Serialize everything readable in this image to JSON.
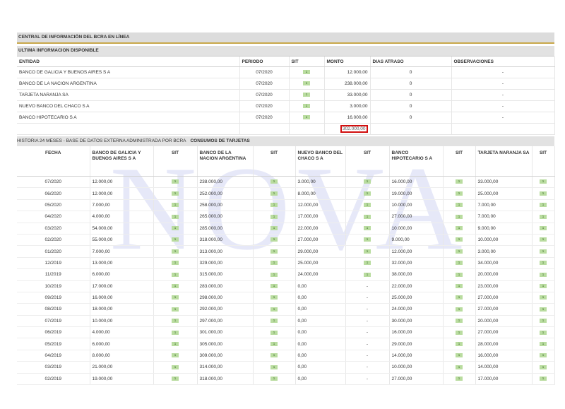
{
  "header": {
    "title": "CENTRAL DE INFORMACIÓN DEL BCRA EN LÍNEA",
    "subtitle": "ULTIMA INFORMACION DISPONIBLE"
  },
  "latest": {
    "columns": [
      "ENTIDAD",
      "PERIODO",
      "SIT",
      "MONTO",
      "DIAS ATRASO",
      "OBSERVACIONES"
    ],
    "rows": [
      {
        "entity": "BANCO DE GALICIA Y BUENOS AIRES S A",
        "period": "07/2020",
        "sit": "1",
        "amount": "12.000,00",
        "days": "0",
        "obs": "-"
      },
      {
        "entity": "BANCO DE LA NACION ARGENTINA",
        "period": "07/2020",
        "sit": "1",
        "amount": "238.000,00",
        "days": "0",
        "obs": "-"
      },
      {
        "entity": "TARJETA NARANJA SA",
        "period": "07/2020",
        "sit": "1",
        "amount": "33.000,00",
        "days": "0",
        "obs": "-"
      },
      {
        "entity": "NUEVO BANCO DEL CHACO S A",
        "period": "07/2020",
        "sit": "1",
        "amount": "3.000,00",
        "days": "0",
        "obs": "-"
      },
      {
        "entity": "BANCO HIPOTECARIO S A",
        "period": "07/2020",
        "sit": "1",
        "amount": "16.000,00",
        "days": "0",
        "obs": "-"
      }
    ],
    "total": "302.000,00"
  },
  "history": {
    "title": "HISTORIA 24 MESES - BASE DE DATOS EXTERNA ADMINISTRADA POR BCRA",
    "subtitle": "CONSUMOS DE TARJETAS",
    "columns": [
      "FECHA",
      "BANCO DE GALICIA Y BUENOS AIRES S A",
      "SIT",
      "BANCO DE LA NACION ARGENTINA",
      "SIT",
      "NUEVO BANCO DEL CHACO S A",
      "SIT",
      "BANCO HIPOTECARIO S A",
      "SIT",
      "TARJETA NARANJA SA",
      "SIT"
    ],
    "rows": [
      [
        "07/2020",
        "12.000,00",
        "1",
        "238.000,00",
        "1",
        "3.000,00",
        "1",
        "16.000,00",
        "1",
        "33.000,00",
        "1"
      ],
      [
        "06/2020",
        "12.000,00",
        "1",
        "252.000,00",
        "1",
        "8.000,00",
        "1",
        "19.000,00",
        "1",
        "25.000,00",
        "1"
      ],
      [
        "05/2020",
        "7.000,00",
        "1",
        "258.000,00",
        "1",
        "12.000,00",
        "1",
        "10.000,00",
        "1",
        "7.000,00",
        "1"
      ],
      [
        "04/2020",
        "4.000,00",
        "1",
        "265.000,00",
        "1",
        "17.000,00",
        "1",
        "27.000,00",
        "1",
        "7.000,00",
        "1"
      ],
      [
        "03/2020",
        "54.000,00",
        "1",
        "285.000,00",
        "1",
        "22.000,00",
        "1",
        "10.000,00",
        "1",
        "9.000,00",
        "1"
      ],
      [
        "02/2020",
        "55.000,00",
        "1",
        "318.000,00",
        "1",
        "27.000,00",
        "1",
        "9.000,00",
        "1",
        "10.000,00",
        "1"
      ],
      [
        "01/2020",
        "7.000,00",
        "1",
        "313.000,00",
        "1",
        "29.000,00",
        "1",
        "12.000,00",
        "1",
        "3.000,00",
        "1"
      ],
      [
        "12/2019",
        "13.000,00",
        "1",
        "329.000,00",
        "1",
        "25.000,00",
        "1",
        "32.000,00",
        "1",
        "34.000,00",
        "1"
      ],
      [
        "11/2019",
        "6.000,00",
        "1",
        "315.000,00",
        "1",
        "24.000,00",
        "1",
        "38.000,00",
        "1",
        "20.000,00",
        "1"
      ],
      [
        "10/2019",
        "17.000,00",
        "1",
        "283.000,00",
        "1",
        "0,00",
        "-",
        "22.000,00",
        "1",
        "23.000,00",
        "1"
      ],
      [
        "09/2019",
        "16.000,00",
        "1",
        "298.000,00",
        "1",
        "0,00",
        "-",
        "25.000,00",
        "1",
        "27.000,00",
        "1"
      ],
      [
        "08/2019",
        "18.000,00",
        "1",
        "292.000,00",
        "1",
        "0,00",
        "-",
        "24.000,00",
        "1",
        "27.000,00",
        "1"
      ],
      [
        "07/2019",
        "10.000,00",
        "1",
        "297.000,00",
        "1",
        "0,00",
        "-",
        "30.000,00",
        "1",
        "20.000,00",
        "1"
      ],
      [
        "06/2019",
        "4.000,00",
        "1",
        "301.000,00",
        "1",
        "0,00",
        "-",
        "16.000,00",
        "1",
        "27.000,00",
        "1"
      ],
      [
        "05/2019",
        "6.000,00",
        "1",
        "305.000,00",
        "1",
        "0,00",
        "-",
        "29.000,00",
        "1",
        "28.000,00",
        "1"
      ],
      [
        "04/2019",
        "8.000,00",
        "1",
        "309.000,00",
        "1",
        "0,00",
        "-",
        "14.000,00",
        "1",
        "16.000,00",
        "1"
      ],
      [
        "03/2019",
        "21.000,00",
        "1",
        "314.000,00",
        "1",
        "0,00",
        "-",
        "10.000,00",
        "1",
        "14.000,00",
        "1"
      ],
      [
        "02/2019",
        "19.000,00",
        "1",
        "318.000,00",
        "1",
        "0,00",
        "-",
        "27.000,00",
        "1",
        "17.000,00",
        "1"
      ]
    ]
  },
  "watermark": "NOVA",
  "colors": {
    "sit_badge": "#b9dc9f",
    "highlight_border": "#d20f0f",
    "header_bar": "#dcdcdc"
  }
}
